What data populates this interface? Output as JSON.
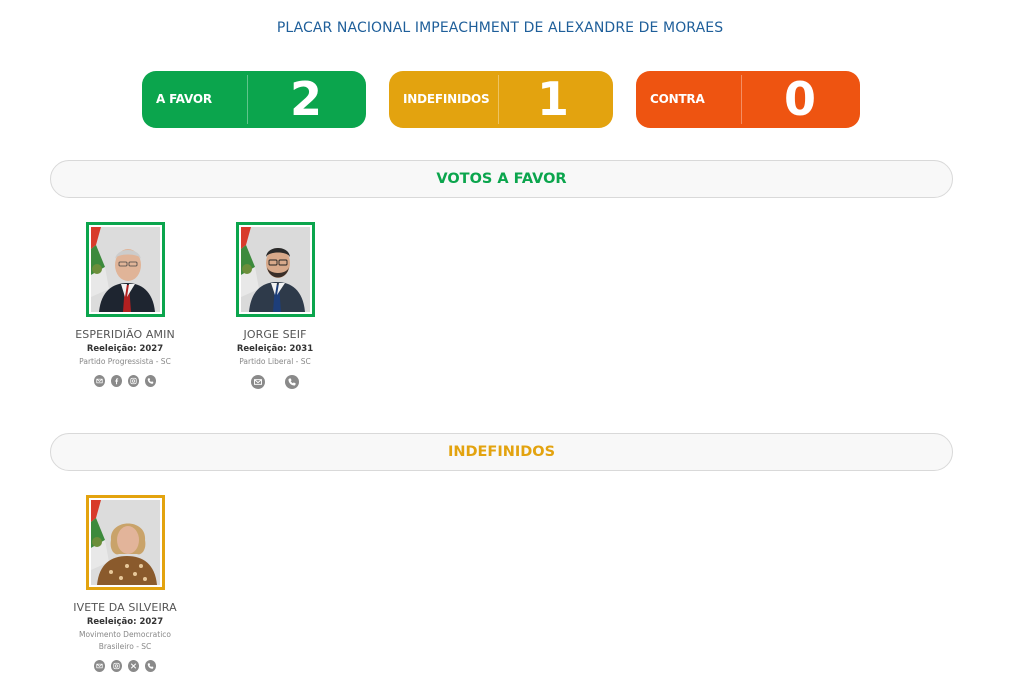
{
  "title": "PLACAR NACIONAL IMPEACHMENT DE ALEXANDRE DE MORAES",
  "scoreboard": {
    "favor": {
      "label": "A FAVOR",
      "count": "2"
    },
    "indefinidos": {
      "label": "INDEFINIDOS",
      "count": "1"
    },
    "contra": {
      "label": "CONTRA",
      "count": "0"
    }
  },
  "sections": {
    "favor": {
      "title": "VOTOS A FAVOR"
    },
    "indefinidos": {
      "title": "INDEFINIDOS"
    }
  },
  "senators": [
    {
      "name": "ESPERIDIÃO AMIN",
      "reelection": "Reeleição: 2027",
      "party_line1": "Partido Progressista - SC",
      "party_line2": "",
      "icons": [
        "email-icon",
        "facebook-icon",
        "instagram-icon",
        "phone-icon"
      ]
    },
    {
      "name": "JORGE SEIF",
      "reelection": "Reeleição: 2031",
      "party_line1": "Partido Liberal - SC",
      "party_line2": "",
      "icons": [
        "email-icon",
        "phone-icon"
      ]
    },
    {
      "name": "IVETE DA SILVEIRA",
      "reelection": "Reeleição: 2027",
      "party_line1": "Movimento Democratico",
      "party_line2": "Brasileiro - SC",
      "icons": [
        "email-icon",
        "instagram-icon",
        "x-icon",
        "phone-icon"
      ]
    }
  ],
  "colors": {
    "favor": "#0ba54d",
    "indefinidos": "#e3a30f",
    "contra": "#ee5411",
    "title": "#1f5f9a"
  }
}
